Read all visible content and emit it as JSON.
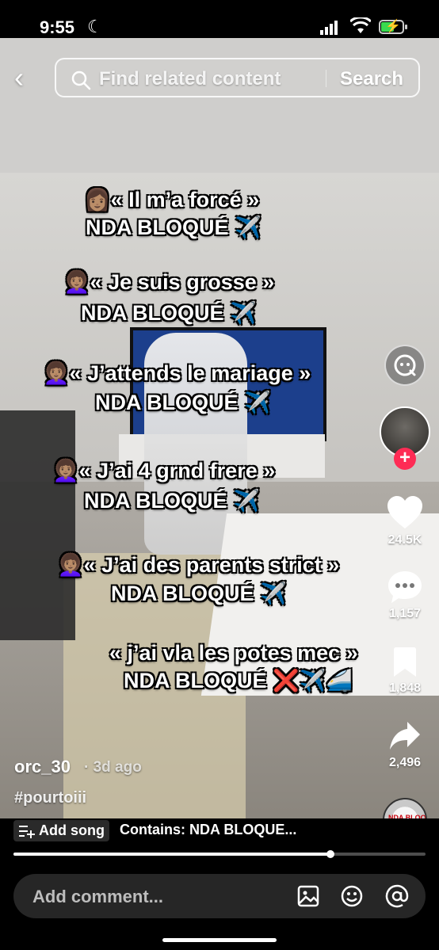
{
  "status_bar": {
    "time": "9:55"
  },
  "search": {
    "placeholder": "Find related content",
    "button_label": "Search"
  },
  "overlay_lines": [
    "👩🏽« Il m’a forcé »",
    "NDA BLOQUÉ ✈️",
    "👩🏽‍🦱« Je suis grosse »",
    "NDA BLOQUÉ ✈️",
    "👩🏽‍🦱« J’attends le mariage »",
    "NDA BLOQUÉ ✈️",
    "👩🏽‍🦱« J’ai 4 grnd frere »",
    "NDA BLOQUÉ ✈️",
    "👩🏽‍🦱« J’ai des parents strict »",
    "NDA BLOQUÉ ✈️",
    "« j’ai vla les potes mec »",
    "NDA BLOQUÉ ❌✈️🚄"
  ],
  "actions": {
    "likes": "24.5K",
    "comments": "1,157",
    "saves": "1,848",
    "shares": "2,496"
  },
  "post": {
    "username": "orc_30",
    "time_ago": "· 3d ago",
    "hashtag": "#pourtoiii"
  },
  "music": {
    "add_song_label": "Add song",
    "contains_text": "Contains: NDA BLOQUE...",
    "disc_text": "NDA BLOQUER"
  },
  "playback": {
    "progress": 0.77
  },
  "comment": {
    "placeholder": "Add comment..."
  },
  "colors": {
    "like": "#ffffff",
    "follow": "#fe2c55",
    "battery": "#3adb4f",
    "comment_bar": "#262626"
  }
}
